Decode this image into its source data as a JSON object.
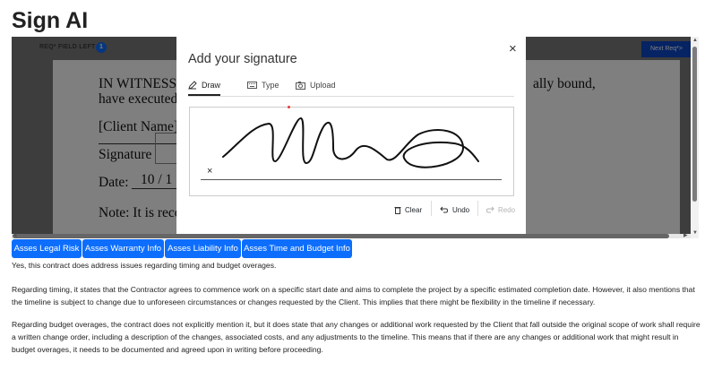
{
  "app": {
    "title": "Sign AI"
  },
  "viewer": {
    "req_left_label": "REQ* FIELD LEFT",
    "req_left_count": "1",
    "next_req_label": "Next Req*>",
    "doc": {
      "line1_a": "IN WITNESS",
      "line1_b": "ally bound,",
      "line2": "have executed",
      "client_name": "[Client Name]",
      "signature_label": "Signature",
      "date_label": "Date:",
      "date_value": "10 / 1",
      "note": "Note: It is reco"
    }
  },
  "modal": {
    "title": "Add your signature",
    "close_glyph": "×",
    "tabs": [
      {
        "label": "Draw",
        "icon": "pen-icon"
      },
      {
        "label": "Type",
        "icon": "keyboard-icon"
      },
      {
        "label": "Upload",
        "icon": "camera-icon"
      }
    ],
    "active_tab": "Draw",
    "pad_x_glyph": "×",
    "actions": {
      "clear": "Clear",
      "undo": "Undo",
      "redo": "Redo"
    }
  },
  "ai_buttons": [
    "Asses Legal Risk",
    "Asses Warranty Info",
    "Asses Liability Info",
    "Asses Time and Budget Info"
  ],
  "response": {
    "p1": "Yes, this contract does address issues regarding timing and budget overages.",
    "p2": "Regarding timing, it states that the Contractor agrees to commence work on a specific start date and aims to complete the project by a specific estimated completion date. However, it also mentions that the timeline is subject to change due to unforeseen circumstances or changes requested by the Client. This implies that there might be flexibility in the timeline if necessary.",
    "p3": "Regarding budget overages, the contract does not explicitly mention it, but it does state that any changes or additional work requested by the Client that fall outside the original scope of work shall require a written change order, including a description of the changes, associated costs, and any adjustments to the timeline. This means that if there are any changes or additional work that might result in budget overages, it needs to be documented and agreed upon in writing before proceeding."
  },
  "colors": {
    "primary": "#0d6efd",
    "next_req": "#0d47c9",
    "overlay": "#7a7a7a",
    "dot": "#e53935"
  }
}
